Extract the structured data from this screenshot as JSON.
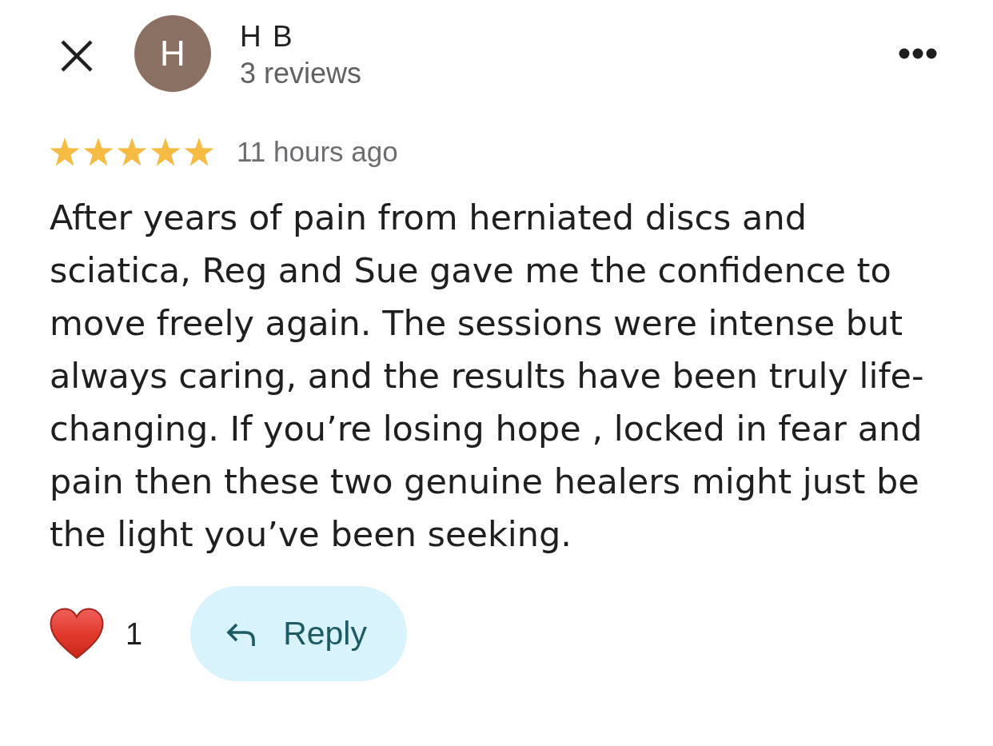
{
  "reviewer": {
    "initial": "H",
    "name": "H B",
    "review_count": "3 reviews"
  },
  "review": {
    "stars": 5,
    "time": "11 hours ago",
    "text": "After years of pain from herniated discs and sciatica, Reg and Sue gave me the confidence to move freely again. The sessions were intense but always caring, and the results have been truly life-changing. If you’re losing hope , locked in fear and pain then these two genuine healers might just be the light you’ve been seeking."
  },
  "actions": {
    "reaction_count": "1",
    "reply_label": "Reply"
  }
}
